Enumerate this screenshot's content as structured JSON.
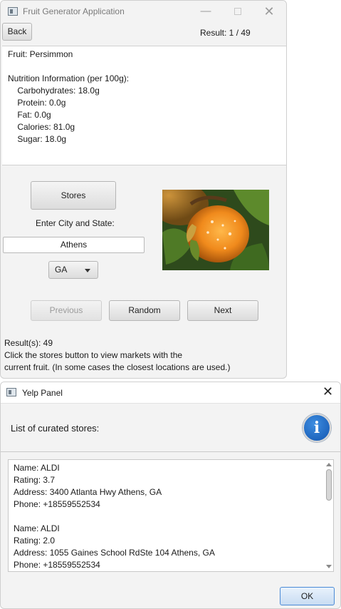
{
  "main_window": {
    "title": "Fruit Generator Application",
    "controls": {
      "minimize": "—",
      "close": "✕"
    },
    "back_label": "Back",
    "result_text": "Result:  1 / 49",
    "info_lines": [
      "Fruit: Persimmon",
      "",
      "Nutrition Information (per 100g):",
      "    Carbohydrates: 18.0g",
      "    Protein: 0.0g",
      "    Fat: 0.0g",
      "    Calories: 81.0g",
      "    Sugar: 18.0g"
    ],
    "stores_label": "Stores",
    "city_label": "Enter City and State:",
    "city_value": "Athens",
    "state_value": "GA",
    "image_icon": "persimmon-photo",
    "previous_label": "Previous",
    "random_label": "Random",
    "next_label": "Next",
    "status_lines": [
      "Result(s): 49",
      "Click the stores button to view markets with the",
      "current fruit. (In some cases the closest locations are used.)"
    ]
  },
  "yelp_dialog": {
    "title": "Yelp Panel",
    "close": "✕",
    "header_text": "List of curated stores:",
    "info_icon_glyph": "i",
    "store_lines": [
      "Name: ALDI",
      "Rating: 3.7",
      "Address: 3400 Atlanta Hwy Athens, GA",
      "Phone: +18559552534",
      "",
      "Name: ALDI",
      "Rating: 2.0",
      "Address: 1055 Gaines School RdSte 104 Athens, GA",
      "Phone: +18559552534"
    ],
    "ok_label": "OK"
  }
}
